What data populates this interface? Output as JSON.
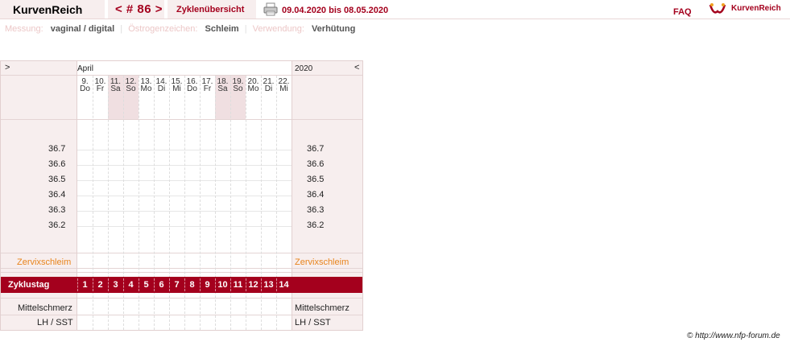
{
  "header": {
    "app_title": "KurvenReich",
    "cycle_nav": "< # 86 >",
    "overview": "Zyklenübersicht",
    "date_range": "09.04.2020 bis 08.05.2020",
    "faq": "FAQ",
    "brand": "KurvenReich"
  },
  "info": {
    "measure_label": "Messung:",
    "measure_value": "vaginal / digital",
    "estrogen_label": "Östrogenzeichen:",
    "estrogen_value": "Schleim",
    "usage_label": "Verwendung:",
    "usage_value": "Verhütung",
    "separator": "|"
  },
  "chart": {
    "prev_arrow": ">",
    "next_arrow": "<",
    "month": "April",
    "year": "2020",
    "days": [
      {
        "num": "9.",
        "wd": "Do",
        "weekend": false
      },
      {
        "num": "10.",
        "wd": "Fr",
        "weekend": false
      },
      {
        "num": "11.",
        "wd": "Sa",
        "weekend": true
      },
      {
        "num": "12.",
        "wd": "So",
        "weekend": true
      },
      {
        "num": "13.",
        "wd": "Mo",
        "weekend": false
      },
      {
        "num": "14.",
        "wd": "Di",
        "weekend": false
      },
      {
        "num": "15.",
        "wd": "Mi",
        "weekend": false
      },
      {
        "num": "16.",
        "wd": "Do",
        "weekend": false
      },
      {
        "num": "17.",
        "wd": "Fr",
        "weekend": false
      },
      {
        "num": "18.",
        "wd": "Sa",
        "weekend": true
      },
      {
        "num": "19.",
        "wd": "So",
        "weekend": true
      },
      {
        "num": "20.",
        "wd": "Mo",
        "weekend": false
      },
      {
        "num": "21.",
        "wd": "Di",
        "weekend": false
      },
      {
        "num": "22.",
        "wd": "Mi",
        "weekend": false
      }
    ],
    "temps": [
      "36.7",
      "36.6",
      "36.5",
      "36.4",
      "36.3",
      "36.2"
    ],
    "cervix_label": "Zervixschleim",
    "cycle_day_label": "Zyklustag",
    "cycle_days": [
      "1",
      "2",
      "3",
      "4",
      "5",
      "6",
      "7",
      "8",
      "9",
      "10",
      "11",
      "12",
      "13",
      "14"
    ],
    "mittelschmerz_label": "Mittelschmerz",
    "lh_label": "LH / SST"
  },
  "colors": {
    "accent": "#a4001d",
    "panel_bg": "#f7eeee",
    "weekend_bg": "#f0dfe1",
    "cervix": "#e8841c"
  },
  "footer": {
    "copyright": "© http://www.nfp-forum.de"
  }
}
